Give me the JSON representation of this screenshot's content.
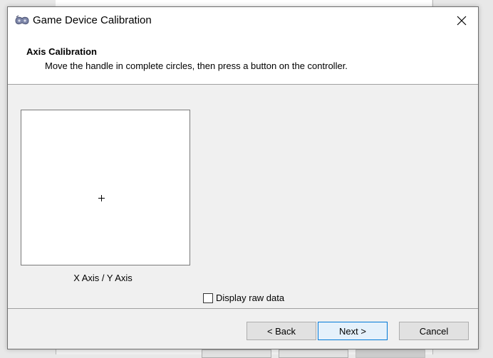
{
  "window": {
    "title": "Game Device Calibration",
    "close_symbol": "✕"
  },
  "header": {
    "title": "Axis Calibration",
    "subtitle": "Move the handle in complete circles, then press a button on the controller."
  },
  "axis_panel": {
    "label": "X Axis / Y Axis",
    "crosshair_icon": "crosshair-icon"
  },
  "options": {
    "raw_data_label": "Display raw data",
    "raw_data_checked": false
  },
  "buttons": {
    "back": "< Back",
    "next": "Next >",
    "cancel": "Cancel"
  },
  "colors": {
    "accent": "#0078d7",
    "dialog_bg": "#f0f0f0",
    "header_bg": "#ffffff"
  }
}
